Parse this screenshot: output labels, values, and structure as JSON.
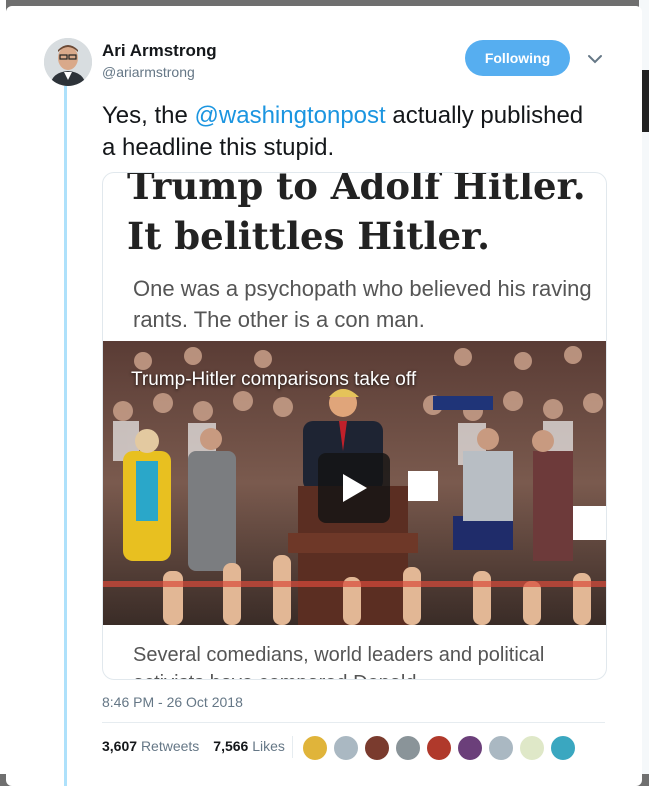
{
  "tweet": {
    "author_name": "Ari Armstrong",
    "author_handle": "@ariarmstrong",
    "follow_label": "Following",
    "text_before": "Yes, the ",
    "mention": "@washingtonpost",
    "text_after": " actually published a headline this stupid.",
    "timestamp": "8:46 PM - 26 Oct 2018"
  },
  "card": {
    "headline_line1": "Trump to Adolf Hitler.",
    "headline_line2": "It belittles Hitler.",
    "subhead": "One was a psychopath who believed his raving rants. The other is a con man.",
    "video_title": "Trump-Hitler comparisons take off",
    "caption": "Several comedians, world leaders and political activists have compared Donald"
  },
  "stats": {
    "retweets_count": "3,607",
    "retweets_label": "Retweets",
    "likes_count": "7,566",
    "likes_label": "Likes"
  },
  "likers": [
    "#e0b43a",
    "#aab8c2",
    "#7a3b2e",
    "#8a9499",
    "#b0392b",
    "#6b3f7a",
    "#aab8c2",
    "#dfe8c8",
    "#3aa7c0"
  ],
  "colors": {
    "accent": "#1b95e0",
    "follow_button": "#56aef0",
    "thread_line": "#aee1fb"
  }
}
